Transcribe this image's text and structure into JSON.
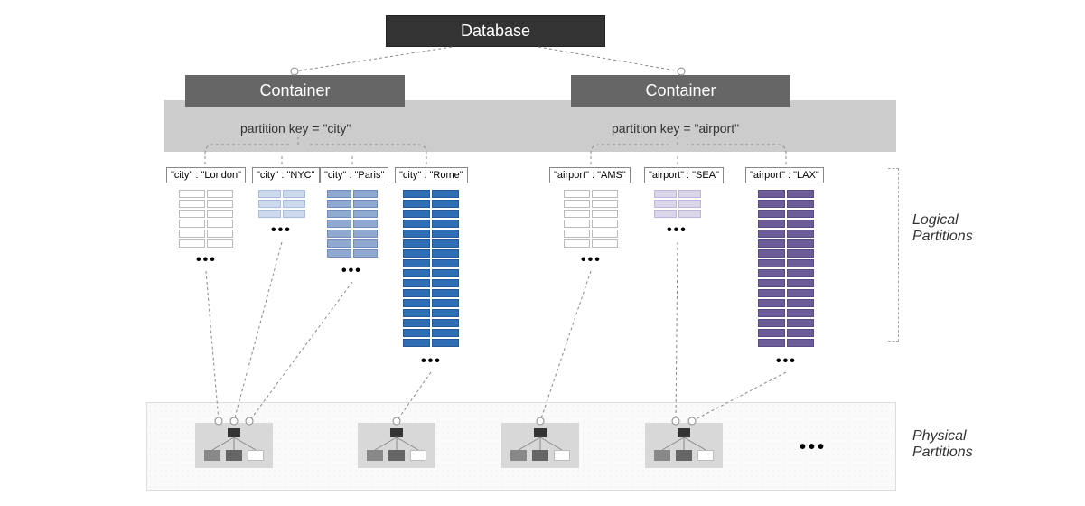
{
  "database": {
    "label": "Database"
  },
  "containers": {
    "left": {
      "label": "Container",
      "partition_key_text": "partition key = \"city\""
    },
    "right": {
      "label": "Container",
      "partition_key_text": "partition key = \"airport\""
    }
  },
  "partitions": {
    "london": {
      "label": "\"city\" : \"London\"",
      "rows": 6,
      "color": "#ffffff",
      "border": "#bbbbbb"
    },
    "nyc": {
      "label": "\"city\" : \"NYC\"",
      "rows": 3,
      "color": "#cdd9ec",
      "border": "#a8bde0"
    },
    "paris": {
      "label": "\"city\" : \"Paris\"",
      "rows": 7,
      "color": "#8fa9d0",
      "border": "#6e8cbf"
    },
    "rome": {
      "label": "\"city\" : \"Rome\"",
      "rows": 16,
      "color": "#2f6eb5",
      "border": "#245a99"
    },
    "ams": {
      "label": "\"airport\" : \"AMS\"",
      "rows": 6,
      "color": "#ffffff",
      "border": "#bbbbbb"
    },
    "sea": {
      "label": "\"airport\" : \"SEA\"",
      "rows": 3,
      "color": "#dcd6eb",
      "border": "#bfb6dc"
    },
    "lax": {
      "label": "\"airport\" : \"LAX\"",
      "rows": 16,
      "color": "#6c5d99",
      "border": "#594b85"
    }
  },
  "side_labels": {
    "logical": "Logical\nPartitions",
    "physical": "Physical\nPartitions"
  },
  "ellipsis": "•••",
  "physical": {
    "count": 4
  }
}
